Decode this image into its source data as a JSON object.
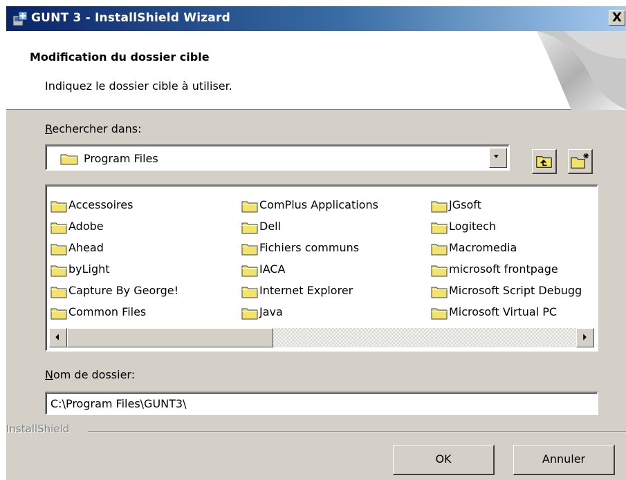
{
  "window": {
    "title": "GUNT 3 - InstallShield Wizard",
    "close_label": "X"
  },
  "header": {
    "title": "Modification du dossier cible",
    "subtitle": "Indiquez le dossier cible à utiliser."
  },
  "look_in": {
    "label_accel": "R",
    "label_rest": "echercher dans:",
    "selected": "Program Files"
  },
  "folders": {
    "columns": [
      [
        "Accessoires",
        "Adobe",
        "Ahead",
        "byLight",
        "Capture By George!",
        "Common Files"
      ],
      [
        "ComPlus Applications",
        "Dell",
        "Fichiers communs",
        "IACA",
        "Internet Explorer",
        "Java"
      ],
      [
        "JGsoft",
        "Logitech",
        "Macromedia",
        "microsoft frontpage",
        "Microsoft Script Debugg",
        "Microsoft Virtual PC"
      ]
    ]
  },
  "folder_name": {
    "label_accel": "N",
    "label_rest": "om de dossier:",
    "value": "C:\\Program Files\\GUNT3\\"
  },
  "footer": {
    "brand": "InstallShield",
    "ok_label": "OK",
    "cancel_label": "Annuler"
  },
  "colors": {
    "titlebar_start": "#0a246a",
    "titlebar_end": "#a6caf0",
    "face": "#d4d0c8",
    "folder_yellow": "#f4e36a"
  }
}
